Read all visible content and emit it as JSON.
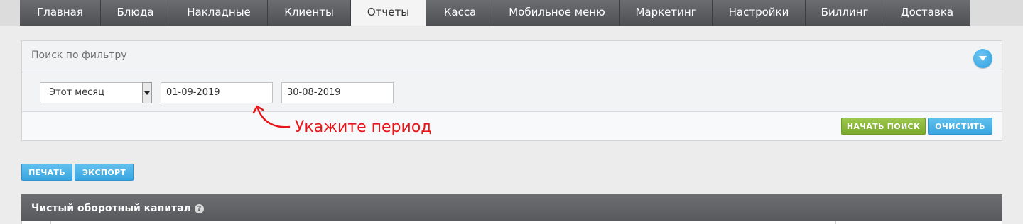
{
  "nav": {
    "tabs": [
      {
        "label": "Главная",
        "active": false
      },
      {
        "label": "Блюда",
        "active": false
      },
      {
        "label": "Накладные",
        "active": false
      },
      {
        "label": "Клиенты",
        "active": false
      },
      {
        "label": "Отчеты",
        "active": true
      },
      {
        "label": "Касса",
        "active": false
      },
      {
        "label": "Мобильное меню",
        "active": false
      },
      {
        "label": "Маркетинг",
        "active": false
      },
      {
        "label": "Настройки",
        "active": false
      },
      {
        "label": "Биллинг",
        "active": false
      },
      {
        "label": "Доставка",
        "active": false
      }
    ]
  },
  "filter": {
    "title": "Поиск по фильтру",
    "period_select": "Этот месяц",
    "date_from": "01-09-2019",
    "date_to": "30-08-2019",
    "search_button": "НАЧАТЬ ПОИСК",
    "clear_button": "ОЧИСТИТЬ"
  },
  "annotation": {
    "text": "Укажите период",
    "color": "#e8161a"
  },
  "actions": {
    "print": "ПЕЧАТЬ",
    "export": "ЭКСПОРТ"
  },
  "report": {
    "title": "Чистый оборотный капитал",
    "help": "?"
  },
  "colors": {
    "accent_blue": "#3aa5df",
    "accent_green": "#7aa92e",
    "nav_dark": "#55575b"
  }
}
